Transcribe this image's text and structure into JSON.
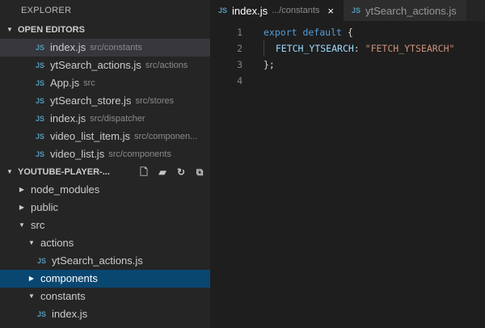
{
  "sidebar": {
    "title": "EXPLORER",
    "open_editors": {
      "header": "OPEN EDITORS",
      "items": [
        {
          "name": "index.js",
          "path": "src/constants"
        },
        {
          "name": "ytSearch_actions.js",
          "path": "src/actions"
        },
        {
          "name": "App.js",
          "path": "src"
        },
        {
          "name": "ytSearch_store.js",
          "path": "src/stores"
        },
        {
          "name": "index.js",
          "path": "src/dispatcher"
        },
        {
          "name": "video_list_item.js",
          "path": "src/componen..."
        },
        {
          "name": "video_list.js",
          "path": "src/components"
        }
      ]
    },
    "project": {
      "header": "YOUTUBE-PLAYER-...",
      "actions": [
        "new-file-icon",
        "new-folder-icon",
        "refresh-icon",
        "collapse-all-icon"
      ],
      "tree": [
        {
          "label": "node_modules",
          "kind": "folder",
          "state": "collapsed"
        },
        {
          "label": "public",
          "kind": "folder",
          "state": "collapsed"
        },
        {
          "label": "src",
          "kind": "folder",
          "state": "expanded"
        },
        {
          "label": "actions",
          "kind": "folder",
          "state": "expanded"
        },
        {
          "label": "ytSearch_actions.js",
          "kind": "file"
        },
        {
          "label": "components",
          "kind": "folder",
          "state": "collapsed"
        },
        {
          "label": "constants",
          "kind": "folder",
          "state": "expanded"
        },
        {
          "label": "index.js",
          "kind": "file"
        }
      ]
    },
    "file_badge": "JS"
  },
  "editor": {
    "tabs": [
      {
        "name": "index.js",
        "desc": ".../constants",
        "close": "×"
      },
      {
        "name": "ytSearch_actions.js"
      }
    ],
    "line_numbers": [
      "1",
      "2",
      "3",
      "4"
    ],
    "code": {
      "l1_kw": "export default",
      "l1_brace": " {",
      "l2_key": "FETCH_YTSEARCH",
      "l2_colon": ": ",
      "l2_value": "\"FETCH_YTSEARCH\"",
      "l3": "};"
    }
  },
  "colors": {
    "selection": "#094771",
    "js_badge": "#519aba",
    "keyword": "#569cd6",
    "string": "#ce9178"
  }
}
